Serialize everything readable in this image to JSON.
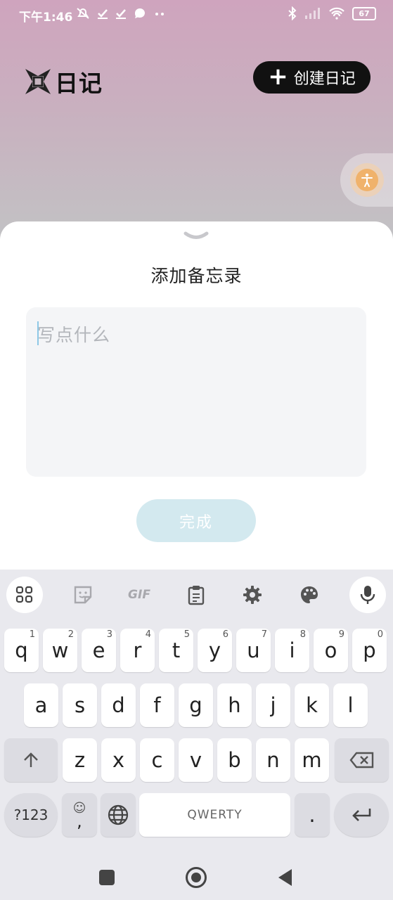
{
  "status_bar": {
    "time": "下午1:46",
    "battery": "67",
    "left_icons": [
      "mute-icon",
      "check-icon",
      "check-icon",
      "chat-icon",
      "more-icon"
    ],
    "right_icons": [
      "bluetooth-icon",
      "signal-icon",
      "wifi-icon",
      "battery-icon"
    ]
  },
  "header": {
    "title": "日记",
    "create_label": "创建日记"
  },
  "sheet": {
    "title": "添加备忘录",
    "placeholder": "写点什么",
    "done_label": "完成"
  },
  "keyboard": {
    "toolbar": [
      "apps-icon",
      "sticker-icon",
      "gif-icon",
      "clipboard-icon",
      "settings-icon",
      "palette-icon",
      "mic-icon"
    ],
    "gif_label": "GIF",
    "row1": [
      {
        "k": "q",
        "n": "1"
      },
      {
        "k": "w",
        "n": "2"
      },
      {
        "k": "e",
        "n": "3"
      },
      {
        "k": "r",
        "n": "4"
      },
      {
        "k": "t",
        "n": "5"
      },
      {
        "k": "y",
        "n": "6"
      },
      {
        "k": "u",
        "n": "7"
      },
      {
        "k": "i",
        "n": "8"
      },
      {
        "k": "o",
        "n": "9"
      },
      {
        "k": "p",
        "n": "0"
      }
    ],
    "row2": [
      "a",
      "s",
      "d",
      "f",
      "g",
      "h",
      "j",
      "k",
      "l"
    ],
    "row3": [
      "z",
      "x",
      "c",
      "v",
      "b",
      "n",
      "m"
    ],
    "sym_label": "?123",
    "comma_label": ",",
    "space_label": "QWERTY",
    "period_label": "."
  },
  "colors": {
    "accent_dark": "#111111",
    "done_button": "#d3e9ef",
    "accessibility": "#f0b26b"
  }
}
